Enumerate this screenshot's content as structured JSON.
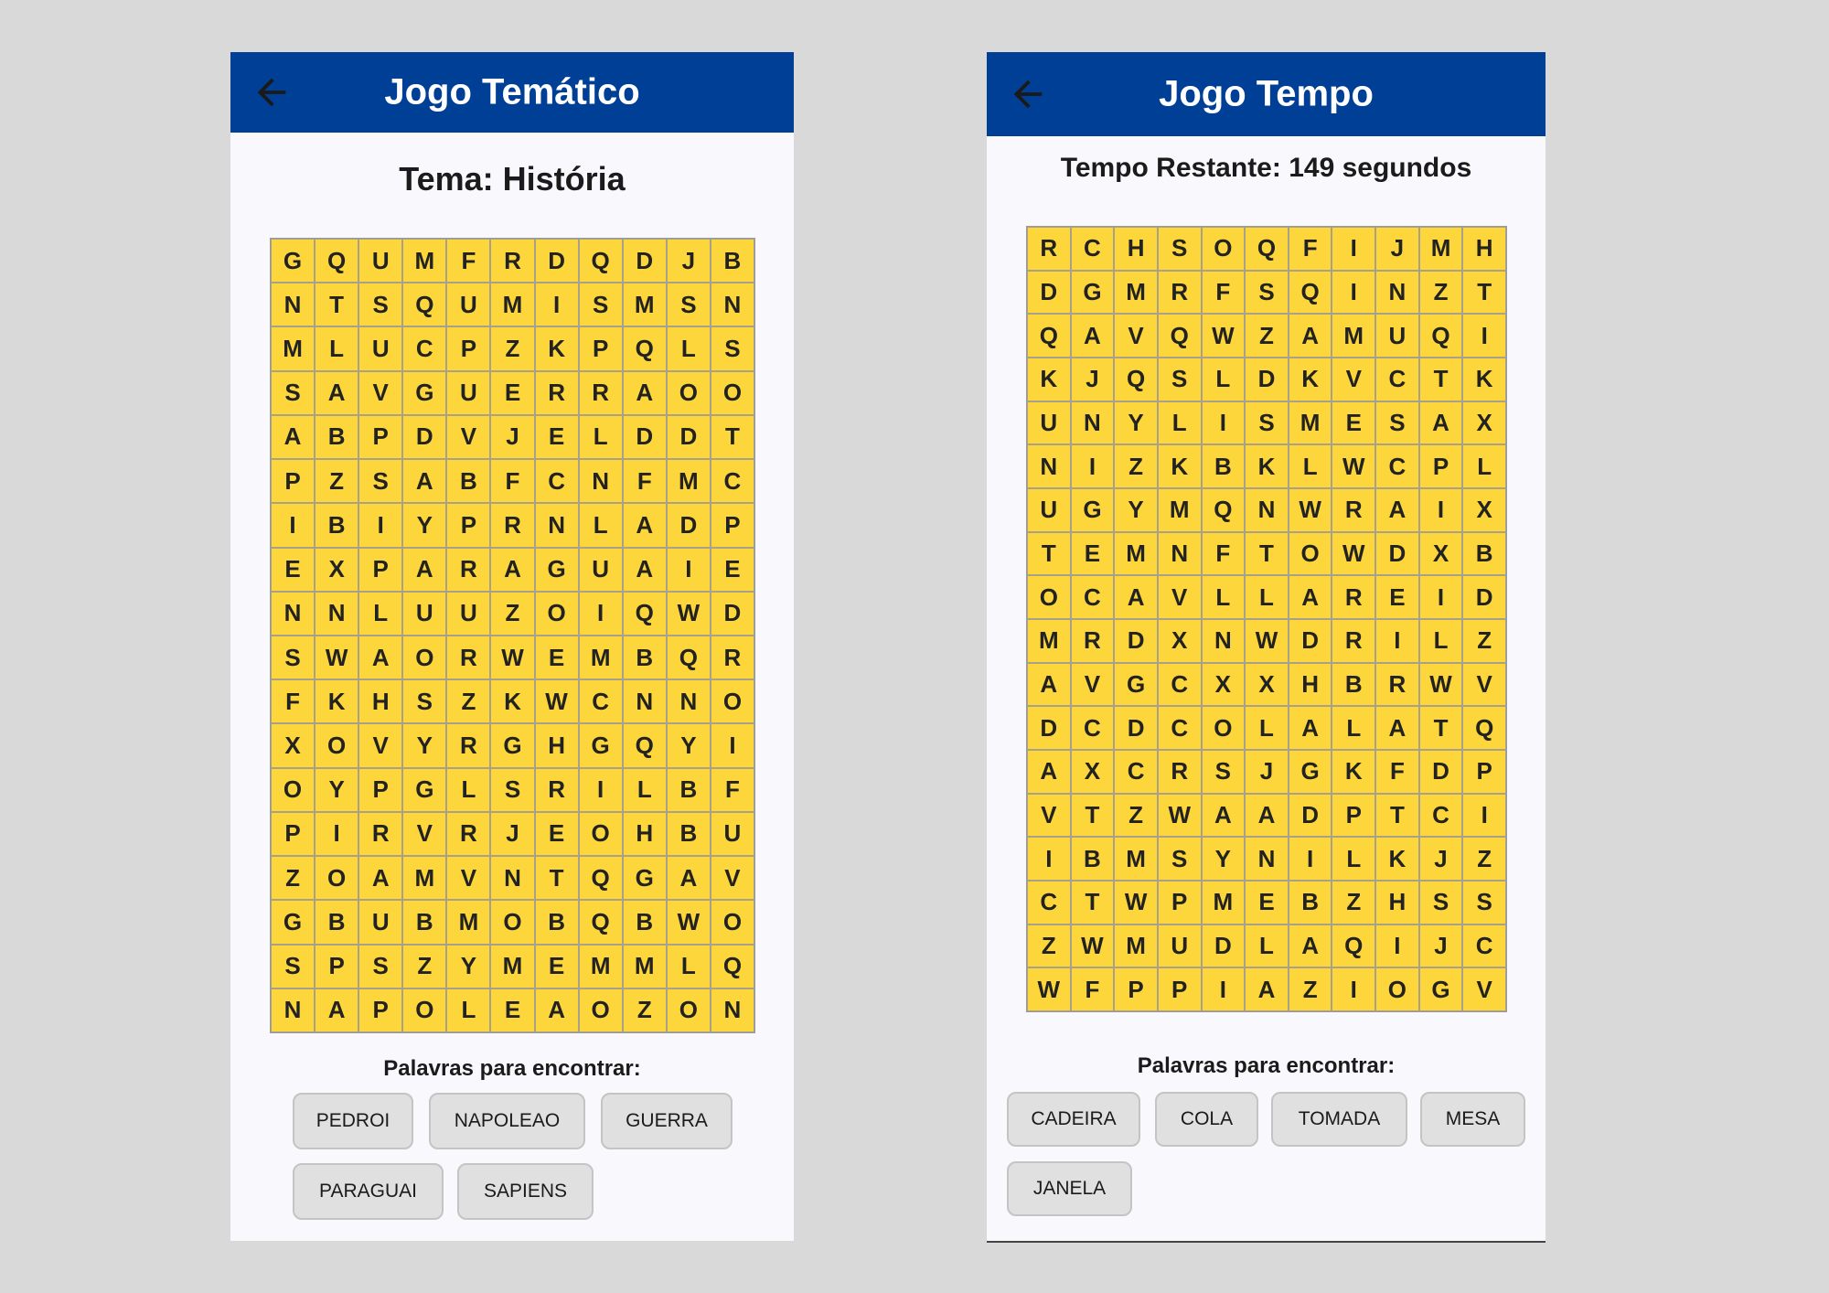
{
  "left": {
    "title": "Jogo Temático",
    "subtitle": "Tema: História",
    "grid": [
      [
        "G",
        "Q",
        "U",
        "M",
        "F",
        "R",
        "D",
        "Q",
        "D",
        "J",
        "B"
      ],
      [
        "N",
        "T",
        "S",
        "Q",
        "U",
        "M",
        "I",
        "S",
        "M",
        "S",
        "N"
      ],
      [
        "M",
        "L",
        "U",
        "C",
        "P",
        "Z",
        "K",
        "P",
        "Q",
        "L",
        "S"
      ],
      [
        "S",
        "A",
        "V",
        "G",
        "U",
        "E",
        "R",
        "R",
        "A",
        "O",
        "O"
      ],
      [
        "A",
        "B",
        "P",
        "D",
        "V",
        "J",
        "E",
        "L",
        "D",
        "D",
        "T"
      ],
      [
        "P",
        "Z",
        "S",
        "A",
        "B",
        "F",
        "C",
        "N",
        "F",
        "M",
        "C"
      ],
      [
        "I",
        "B",
        "I",
        "Y",
        "P",
        "R",
        "N",
        "L",
        "A",
        "D",
        "P"
      ],
      [
        "E",
        "X",
        "P",
        "A",
        "R",
        "A",
        "G",
        "U",
        "A",
        "I",
        "E"
      ],
      [
        "N",
        "N",
        "L",
        "U",
        "U",
        "Z",
        "O",
        "I",
        "Q",
        "W",
        "D"
      ],
      [
        "S",
        "W",
        "A",
        "O",
        "R",
        "W",
        "E",
        "M",
        "B",
        "Q",
        "R"
      ],
      [
        "F",
        "K",
        "H",
        "S",
        "Z",
        "K",
        "W",
        "C",
        "N",
        "N",
        "O"
      ],
      [
        "X",
        "O",
        "V",
        "Y",
        "R",
        "G",
        "H",
        "G",
        "Q",
        "Y",
        "I"
      ],
      [
        "O",
        "Y",
        "P",
        "G",
        "L",
        "S",
        "R",
        "I",
        "L",
        "B",
        "F"
      ],
      [
        "P",
        "I",
        "R",
        "V",
        "R",
        "J",
        "E",
        "O",
        "H",
        "B",
        "U"
      ],
      [
        "Z",
        "O",
        "A",
        "M",
        "V",
        "N",
        "T",
        "Q",
        "G",
        "A",
        "V"
      ],
      [
        "G",
        "B",
        "U",
        "B",
        "M",
        "O",
        "B",
        "Q",
        "B",
        "W",
        "O"
      ],
      [
        "S",
        "P",
        "S",
        "Z",
        "Y",
        "M",
        "E",
        "M",
        "M",
        "L",
        "Q"
      ],
      [
        "N",
        "A",
        "P",
        "O",
        "L",
        "E",
        "A",
        "O",
        "Z",
        "O",
        "N"
      ]
    ],
    "words_label": "Palavras para encontrar:",
    "words": [
      "PEDROI",
      "NAPOLEAO",
      "GUERRA",
      "PARAGUAI",
      "SAPIENS"
    ]
  },
  "right": {
    "title": "Jogo Tempo",
    "subtitle": "Tempo Restante: 149 segundos",
    "grid": [
      [
        "R",
        "C",
        "H",
        "S",
        "O",
        "Q",
        "F",
        "I",
        "J",
        "M",
        "H"
      ],
      [
        "D",
        "G",
        "M",
        "R",
        "F",
        "S",
        "Q",
        "I",
        "N",
        "Z",
        "T"
      ],
      [
        "Q",
        "A",
        "V",
        "Q",
        "W",
        "Z",
        "A",
        "M",
        "U",
        "Q",
        "I"
      ],
      [
        "K",
        "J",
        "Q",
        "S",
        "L",
        "D",
        "K",
        "V",
        "C",
        "T",
        "K"
      ],
      [
        "U",
        "N",
        "Y",
        "L",
        "I",
        "S",
        "M",
        "E",
        "S",
        "A",
        "X"
      ],
      [
        "N",
        "I",
        "Z",
        "K",
        "B",
        "K",
        "L",
        "W",
        "C",
        "P",
        "L"
      ],
      [
        "U",
        "G",
        "Y",
        "M",
        "Q",
        "N",
        "W",
        "R",
        "A",
        "I",
        "X"
      ],
      [
        "T",
        "E",
        "M",
        "N",
        "F",
        "T",
        "O",
        "W",
        "D",
        "X",
        "B"
      ],
      [
        "O",
        "C",
        "A",
        "V",
        "L",
        "L",
        "A",
        "R",
        "E",
        "I",
        "D"
      ],
      [
        "M",
        "R",
        "D",
        "X",
        "N",
        "W",
        "D",
        "R",
        "I",
        "L",
        "Z"
      ],
      [
        "A",
        "V",
        "G",
        "C",
        "X",
        "X",
        "H",
        "B",
        "R",
        "W",
        "V"
      ],
      [
        "D",
        "C",
        "D",
        "C",
        "O",
        "L",
        "A",
        "L",
        "A",
        "T",
        "Q"
      ],
      [
        "A",
        "X",
        "C",
        "R",
        "S",
        "J",
        "G",
        "K",
        "F",
        "D",
        "P"
      ],
      [
        "V",
        "T",
        "Z",
        "W",
        "A",
        "A",
        "D",
        "P",
        "T",
        "C",
        "I"
      ],
      [
        "I",
        "B",
        "M",
        "S",
        "Y",
        "N",
        "I",
        "L",
        "K",
        "J",
        "Z"
      ],
      [
        "C",
        "T",
        "W",
        "P",
        "M",
        "E",
        "B",
        "Z",
        "H",
        "S",
        "S"
      ],
      [
        "Z",
        "W",
        "M",
        "U",
        "D",
        "L",
        "A",
        "Q",
        "I",
        "J",
        "C"
      ],
      [
        "W",
        "F",
        "P",
        "P",
        "I",
        "A",
        "Z",
        "I",
        "O",
        "G",
        "V"
      ]
    ],
    "words_label": "Palavras para encontrar:",
    "words": [
      "CADEIRA",
      "COLA",
      "TOMADA",
      "MESA",
      "JANELA"
    ]
  }
}
